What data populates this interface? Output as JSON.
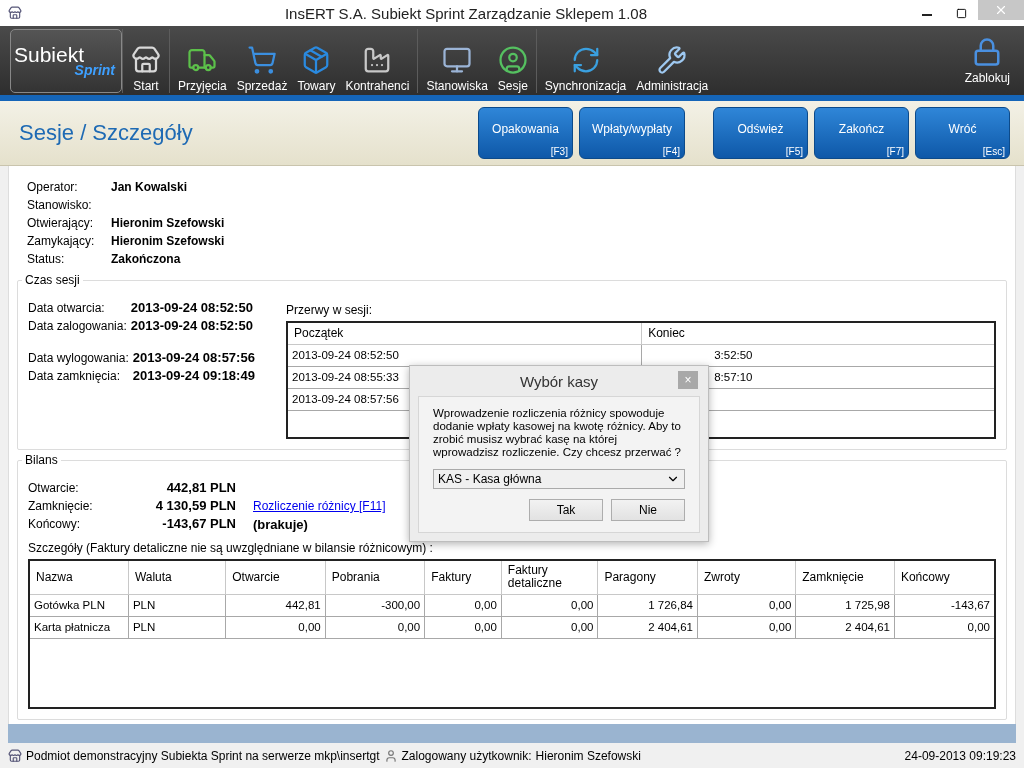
{
  "window": {
    "title": "InsERT S.A. Subiekt Sprint Zarządzanie Sklepem 1.08"
  },
  "toolbar": {
    "logo": {
      "main": "Subiekt",
      "sub": "Sprint"
    },
    "groups": [
      [
        {
          "label": "Start",
          "kind": "store"
        }
      ],
      [
        {
          "label": "Przyjęcia",
          "kind": "truck"
        },
        {
          "label": "Sprzedaż",
          "kind": "cart"
        },
        {
          "label": "Towary",
          "kind": "package"
        },
        {
          "label": "Kontrahenci",
          "kind": "factory"
        }
      ],
      [
        {
          "label": "Stanowiska",
          "kind": "monitor"
        },
        {
          "label": "Sesje",
          "kind": "user"
        }
      ],
      [
        {
          "label": "Synchronizacja",
          "kind": "sync"
        },
        {
          "label": "Administracja",
          "kind": "tools"
        }
      ]
    ],
    "lock": {
      "label": "Zablokuj"
    }
  },
  "page": {
    "title": "Sesje / Szczegóły",
    "button_groups": [
      [
        {
          "label": "Opakowania",
          "shortcut": "[F3]"
        },
        {
          "label": "Wpłaty/wypłaty",
          "shortcut": "[F4]"
        }
      ],
      [
        {
          "label": "Odśwież",
          "shortcut": "[F5]"
        },
        {
          "label": "Zakończ",
          "shortcut": "[F7]"
        },
        {
          "label": "Wróć",
          "shortcut": "[Esc]"
        }
      ]
    ]
  },
  "details": [
    {
      "label": "Operator:",
      "value": "Jan Kowalski"
    },
    {
      "label": "Stanowisko:"
    },
    {
      "label": "Otwierający:",
      "value": "Hieronim Szefowski"
    },
    {
      "label": "Zamykający:",
      "value": "Hieronim Szefowski"
    },
    {
      "label": "Status:",
      "value": "Zakończona"
    }
  ],
  "session_time": {
    "title": "Czas sesji",
    "date_groups": [
      [
        {
          "label": "Data otwarcia:",
          "value": "2013-09-24 08:52:50"
        },
        {
          "label": "Data zalogowania:",
          "value": "2013-09-24 08:52:50"
        }
      ],
      [
        {
          "label": "Data wylogowania:",
          "value": "2013-09-24 08:57:56"
        },
        {
          "label": "Data zamknięcia:",
          "value": "2013-09-24 09:18:49"
        }
      ]
    ],
    "breaks": {
      "label": "Przerwy w sesji:",
      "columns": [
        "Początek",
        "Koniec"
      ],
      "rows": [
        {
          "start": "2013-09-24 08:52:50",
          "end": "3:52:50"
        },
        {
          "start": "2013-09-24 08:55:33",
          "end": "8:57:10"
        },
        {
          "start": "2013-09-24 08:57:56"
        }
      ]
    }
  },
  "balance": {
    "title": "Bilans",
    "rows": [
      {
        "label": "Otwarcie:",
        "value": "442,81 PLN"
      },
      {
        "label": "Zamknięcie:",
        "value": "4 130,59 PLN",
        "link": "Rozliczenie różnicy [F11]"
      },
      {
        "label": "Końcowy:",
        "value": "-143,67 PLN",
        "note": "(brakuje)"
      }
    ],
    "details_label": "Szczegóły (Faktury detaliczne nie są uwzględniane w bilansie różnicowym) :",
    "table": {
      "columns": [
        "Nazwa",
        "Waluta",
        "Otwarcie",
        "Pobrania",
        "Faktury",
        "Faktury detaliczne",
        "Paragony",
        "Zwroty",
        "Zamknięcie",
        "Końcowy"
      ],
      "rows": [
        [
          "Gotówka PLN",
          "PLN",
          "442,81",
          "-300,00",
          "0,00",
          "0,00",
          "1 726,84",
          "0,00",
          "1 725,98",
          "-143,67"
        ],
        [
          "Karta płatnicza",
          "PLN",
          "0,00",
          "0,00",
          "0,00",
          "0,00",
          "2 404,61",
          "0,00",
          "2 404,61",
          "0,00"
        ]
      ]
    }
  },
  "dialog": {
    "title": "Wybór kasy",
    "close": "×",
    "message": "Wprowadzenie rozliczenia różnicy spowoduje dodanie wpłaty kasowej na kwotę różnicy. Aby to zrobić musisz wybrać kasę na której wprowadzisz rozliczenie. Czy chcesz przerwać ?",
    "select": {
      "value": "KAS - Kasa główna"
    },
    "buttons": [
      "Tak",
      "Nie"
    ]
  },
  "status_bar": {
    "company": "Podmiot demonstracyjny Subiekta Sprint na serwerze mkp\\insertgt",
    "user_label": "Zalogowany użytkownik:",
    "user": "Hieronim Szefowski",
    "datetime": "24-09-2013 09:19:23"
  }
}
